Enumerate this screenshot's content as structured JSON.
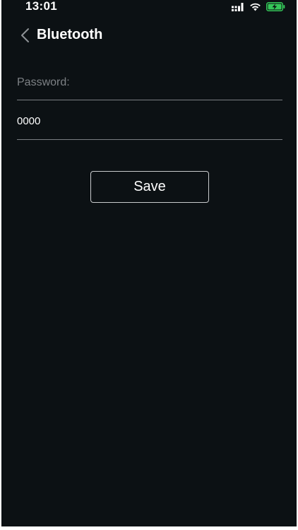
{
  "status_bar": {
    "time": "13:01",
    "icons": [
      "signal-icon",
      "wifi-icon",
      "battery-charging-icon"
    ],
    "battery_color": "#35c759"
  },
  "nav": {
    "title": "Bluetooth",
    "back_icon": "chevron-left-icon"
  },
  "form": {
    "password_label": "Password:",
    "password_value": "0000",
    "save_label": "Save"
  },
  "colors": {
    "background": "#0c1114",
    "text": "#ffffff",
    "label": "#7d8185",
    "divider": "#7a7e82",
    "button_border": "#c9cbcd"
  }
}
